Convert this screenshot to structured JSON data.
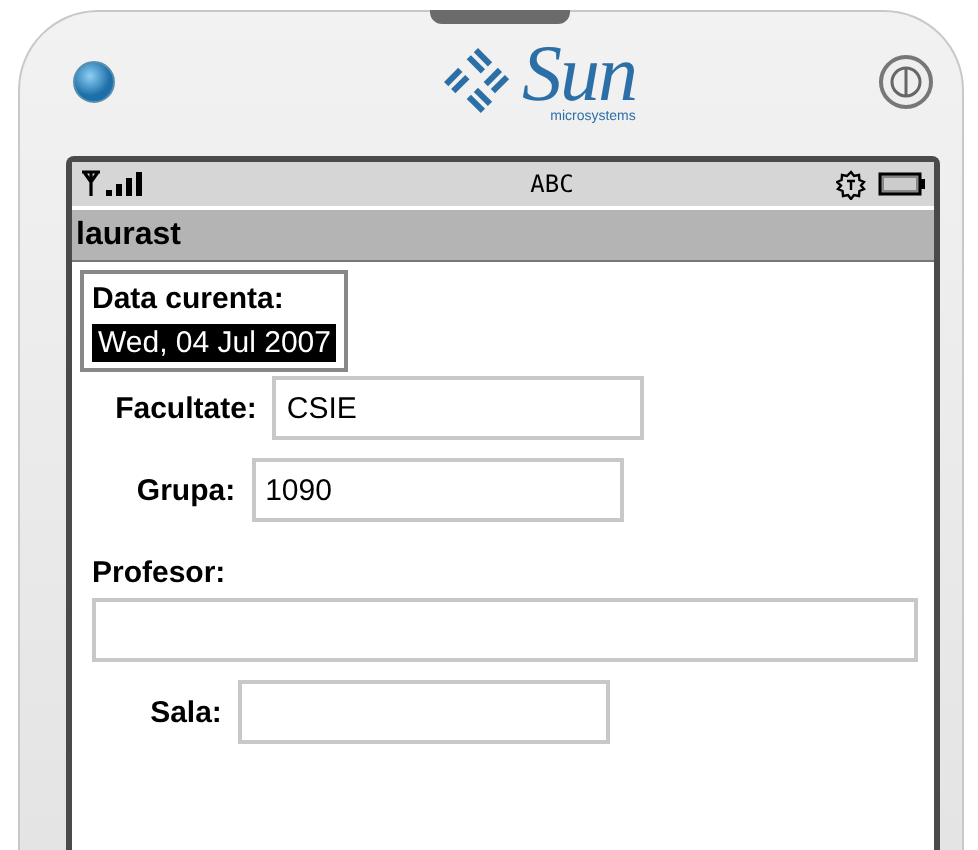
{
  "device": {
    "brand": "Sun",
    "brand_sub": "microsystems"
  },
  "status_bar": {
    "input_mode": "ABC"
  },
  "title": "laurast",
  "items": [
    {
      "kind": "date",
      "label": "Data curenta:",
      "value": "Wed, 04 Jul 2007",
      "selected": true
    },
    {
      "kind": "inline_field",
      "label": "Facultate:",
      "value": "CSIE",
      "selected": false
    },
    {
      "kind": "inline_field",
      "label": "Grupa:",
      "value": "1090",
      "selected": false
    },
    {
      "kind": "stacked_field",
      "label": "Profesor:",
      "selected": false
    },
    {
      "kind": "inline_field",
      "label": "Sala:",
      "selected": false
    }
  ]
}
